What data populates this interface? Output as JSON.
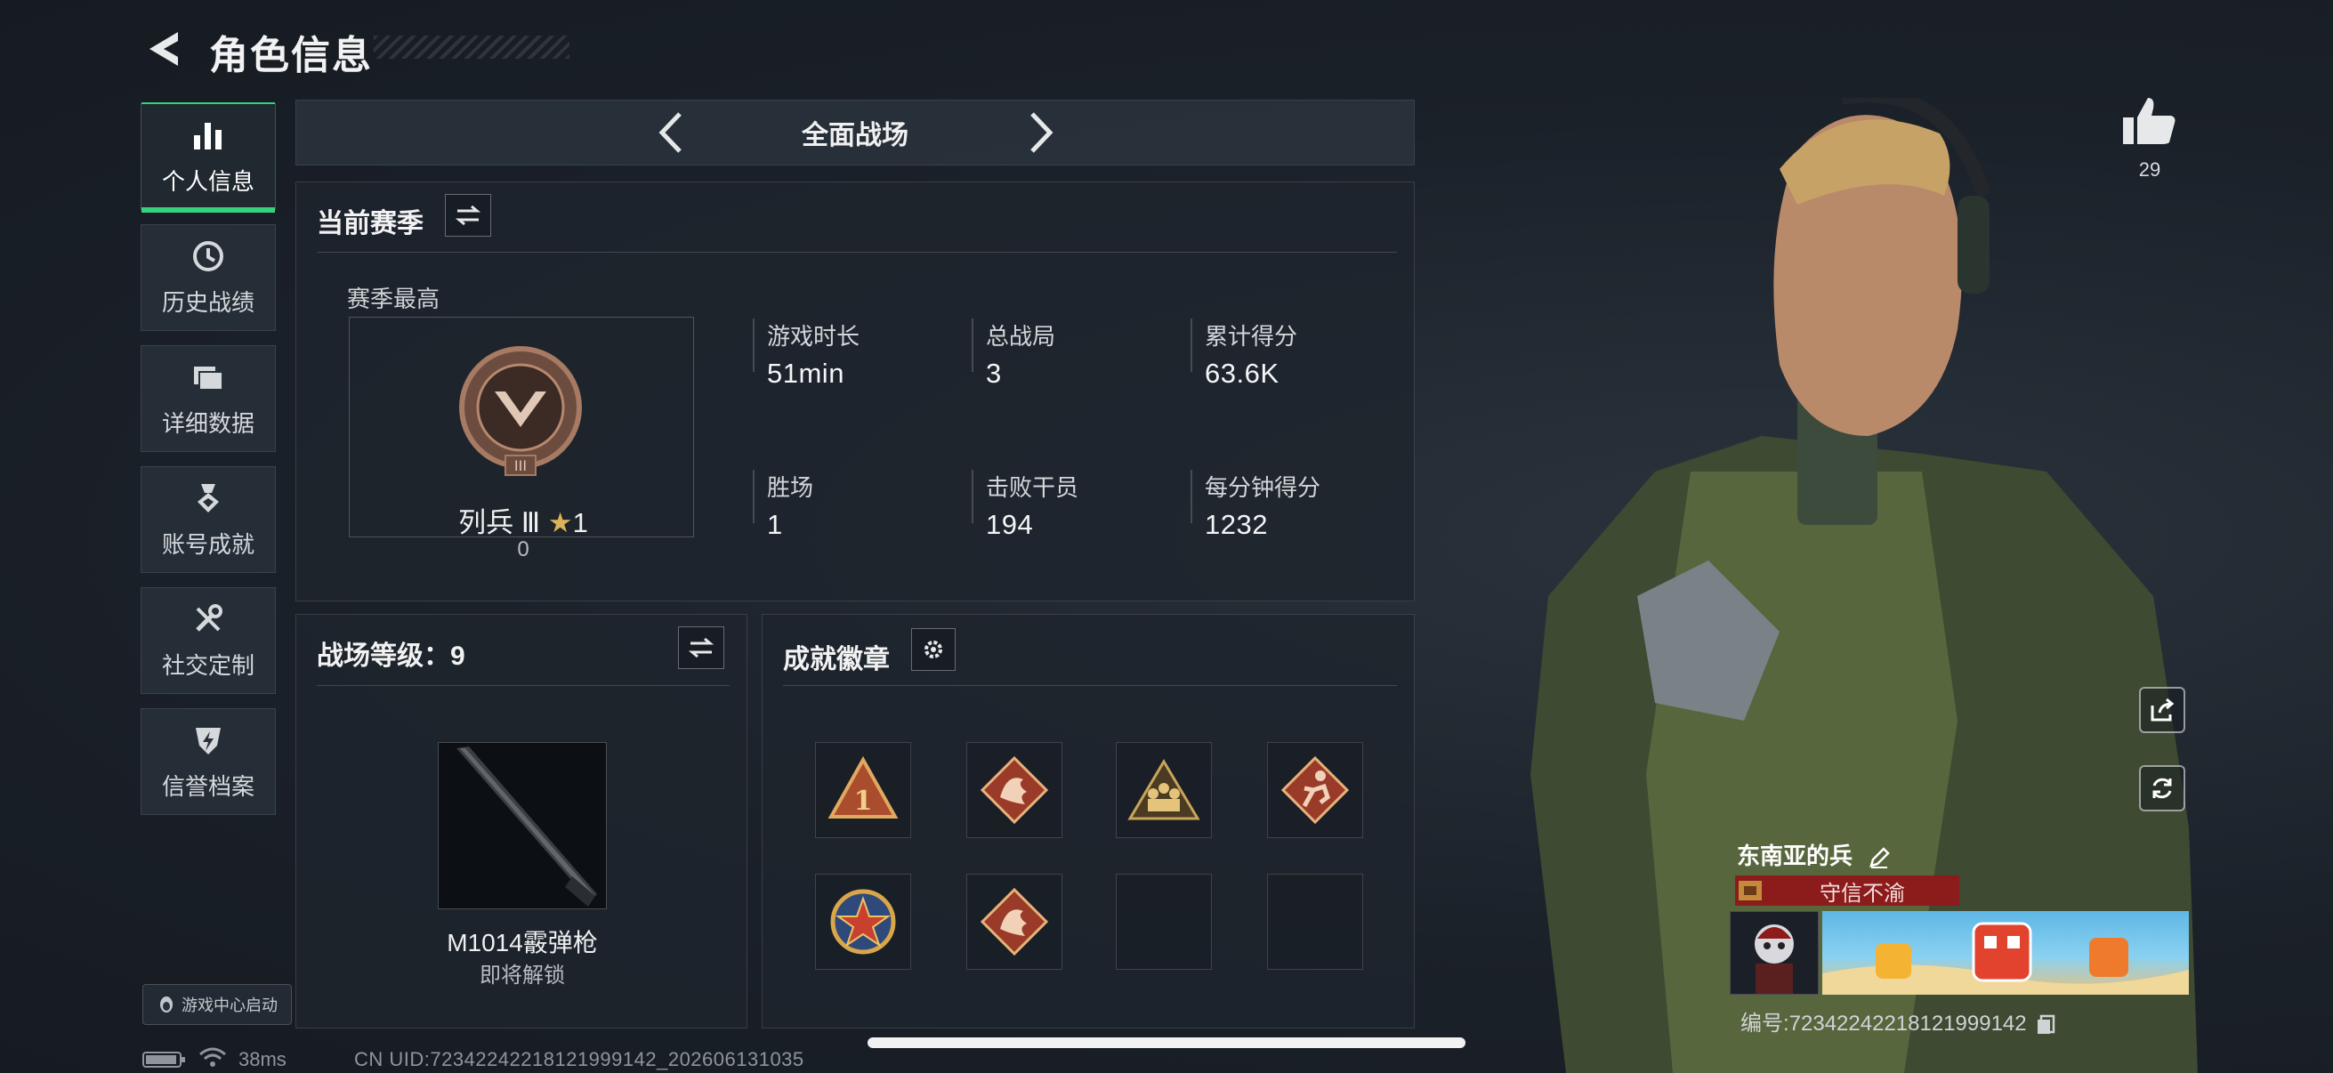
{
  "header": {
    "title": "角色信息"
  },
  "nav": {
    "items": [
      {
        "label": "个人信息",
        "icon": "bar-chart-icon",
        "active": true
      },
      {
        "label": "历史战绩",
        "icon": "history-clock-icon"
      },
      {
        "label": "详细数据",
        "icon": "folder-icon"
      },
      {
        "label": "账号成就",
        "icon": "medal-icon"
      },
      {
        "label": "社交定制",
        "icon": "tools-icon"
      },
      {
        "label": "信誉档案",
        "icon": "shield-bolt-icon"
      }
    ],
    "game_center": "游戏中心启动"
  },
  "mode_selector": {
    "label": "全面战场"
  },
  "season_panel": {
    "title": "当前赛季",
    "best_label": "赛季最高",
    "rank": {
      "name": "列兵 Ⅲ",
      "stars": "1",
      "points": "0"
    },
    "stats": [
      {
        "label": "游戏时长",
        "value": "51min"
      },
      {
        "label": "总战局",
        "value": "3"
      },
      {
        "label": "累计得分",
        "value": "63.6K"
      },
      {
        "label": "胜场",
        "value": "1"
      },
      {
        "label": "击败干员",
        "value": "194"
      },
      {
        "label": "每分钟得分",
        "value": "1232"
      }
    ]
  },
  "level_panel": {
    "title": "战场等级：9",
    "weapon_name": "M1014霰弹枪",
    "weapon_status": "即将解锁"
  },
  "badges_panel": {
    "title": "成就徽章",
    "badges": [
      "triangle-one-badge",
      "dragon-badge",
      "soldiers-badge",
      "runner-badge",
      "star-emblem-badge",
      "dragon-badge",
      "empty",
      "empty"
    ]
  },
  "profile": {
    "likes": "29",
    "name": "东南亚的兵",
    "title_tag": "守信不渝",
    "id": "编号:7234224221812199914​2"
  },
  "footer": {
    "ping": "38ms",
    "uid": "CN UID:72342242218121999142_202606131035"
  },
  "colors": {
    "accent_green": "#34d27f",
    "title_red": "#8c1c1c",
    "background": "#1a2028"
  }
}
